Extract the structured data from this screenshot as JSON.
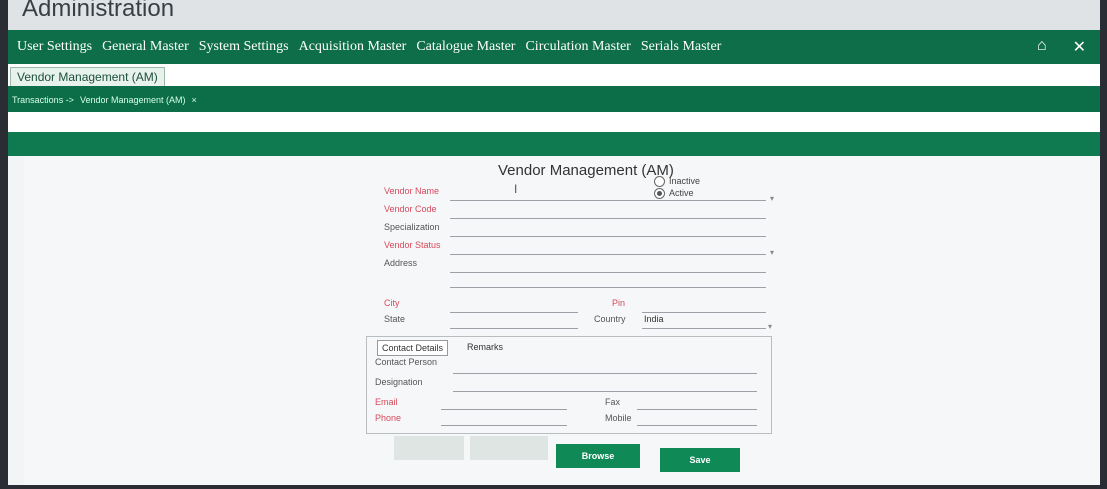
{
  "app_title": "Administration",
  "nav": {
    "items": [
      "User Settings",
      "General Master",
      "System Settings",
      "Acquisition Master",
      "Catalogue Master",
      "Circulation Master",
      "Serials Master"
    ],
    "home_icon": "home-icon",
    "close_icon": "close-icon"
  },
  "sub_tab": {
    "label": "Vendor Management (AM)"
  },
  "breadcrumb": {
    "root": "Transactions ->",
    "current": "Vendor Management (AM)",
    "close": "×"
  },
  "form": {
    "title": "Vendor Management (AM)",
    "status_inactive": "Inactive",
    "status_active": "Active",
    "status_selected": "Active",
    "vendor_name_label": "Vendor Name",
    "vendor_code_label": "Vendor Code",
    "specialization_label": "Specialization",
    "vendor_status_label": "Vendor Status",
    "address_label": "Address",
    "city_label": "City",
    "state_label": "State",
    "pin_label": "Pin",
    "country_label": "Country",
    "country_value": "India",
    "tabs": [
      "Contact Details",
      "Remarks"
    ],
    "contact_person_label": "Contact Person",
    "designation_label": "Designation",
    "email_label": "Email",
    "phone_label": "Phone",
    "fax_label": "Fax",
    "mobile_label": "Mobile",
    "browse_label": "Browse",
    "save_label": "Save"
  },
  "colors": {
    "nav_green": "#0e6e4a",
    "required_label": "#d64a5c",
    "primary_button": "#0f8a57"
  }
}
